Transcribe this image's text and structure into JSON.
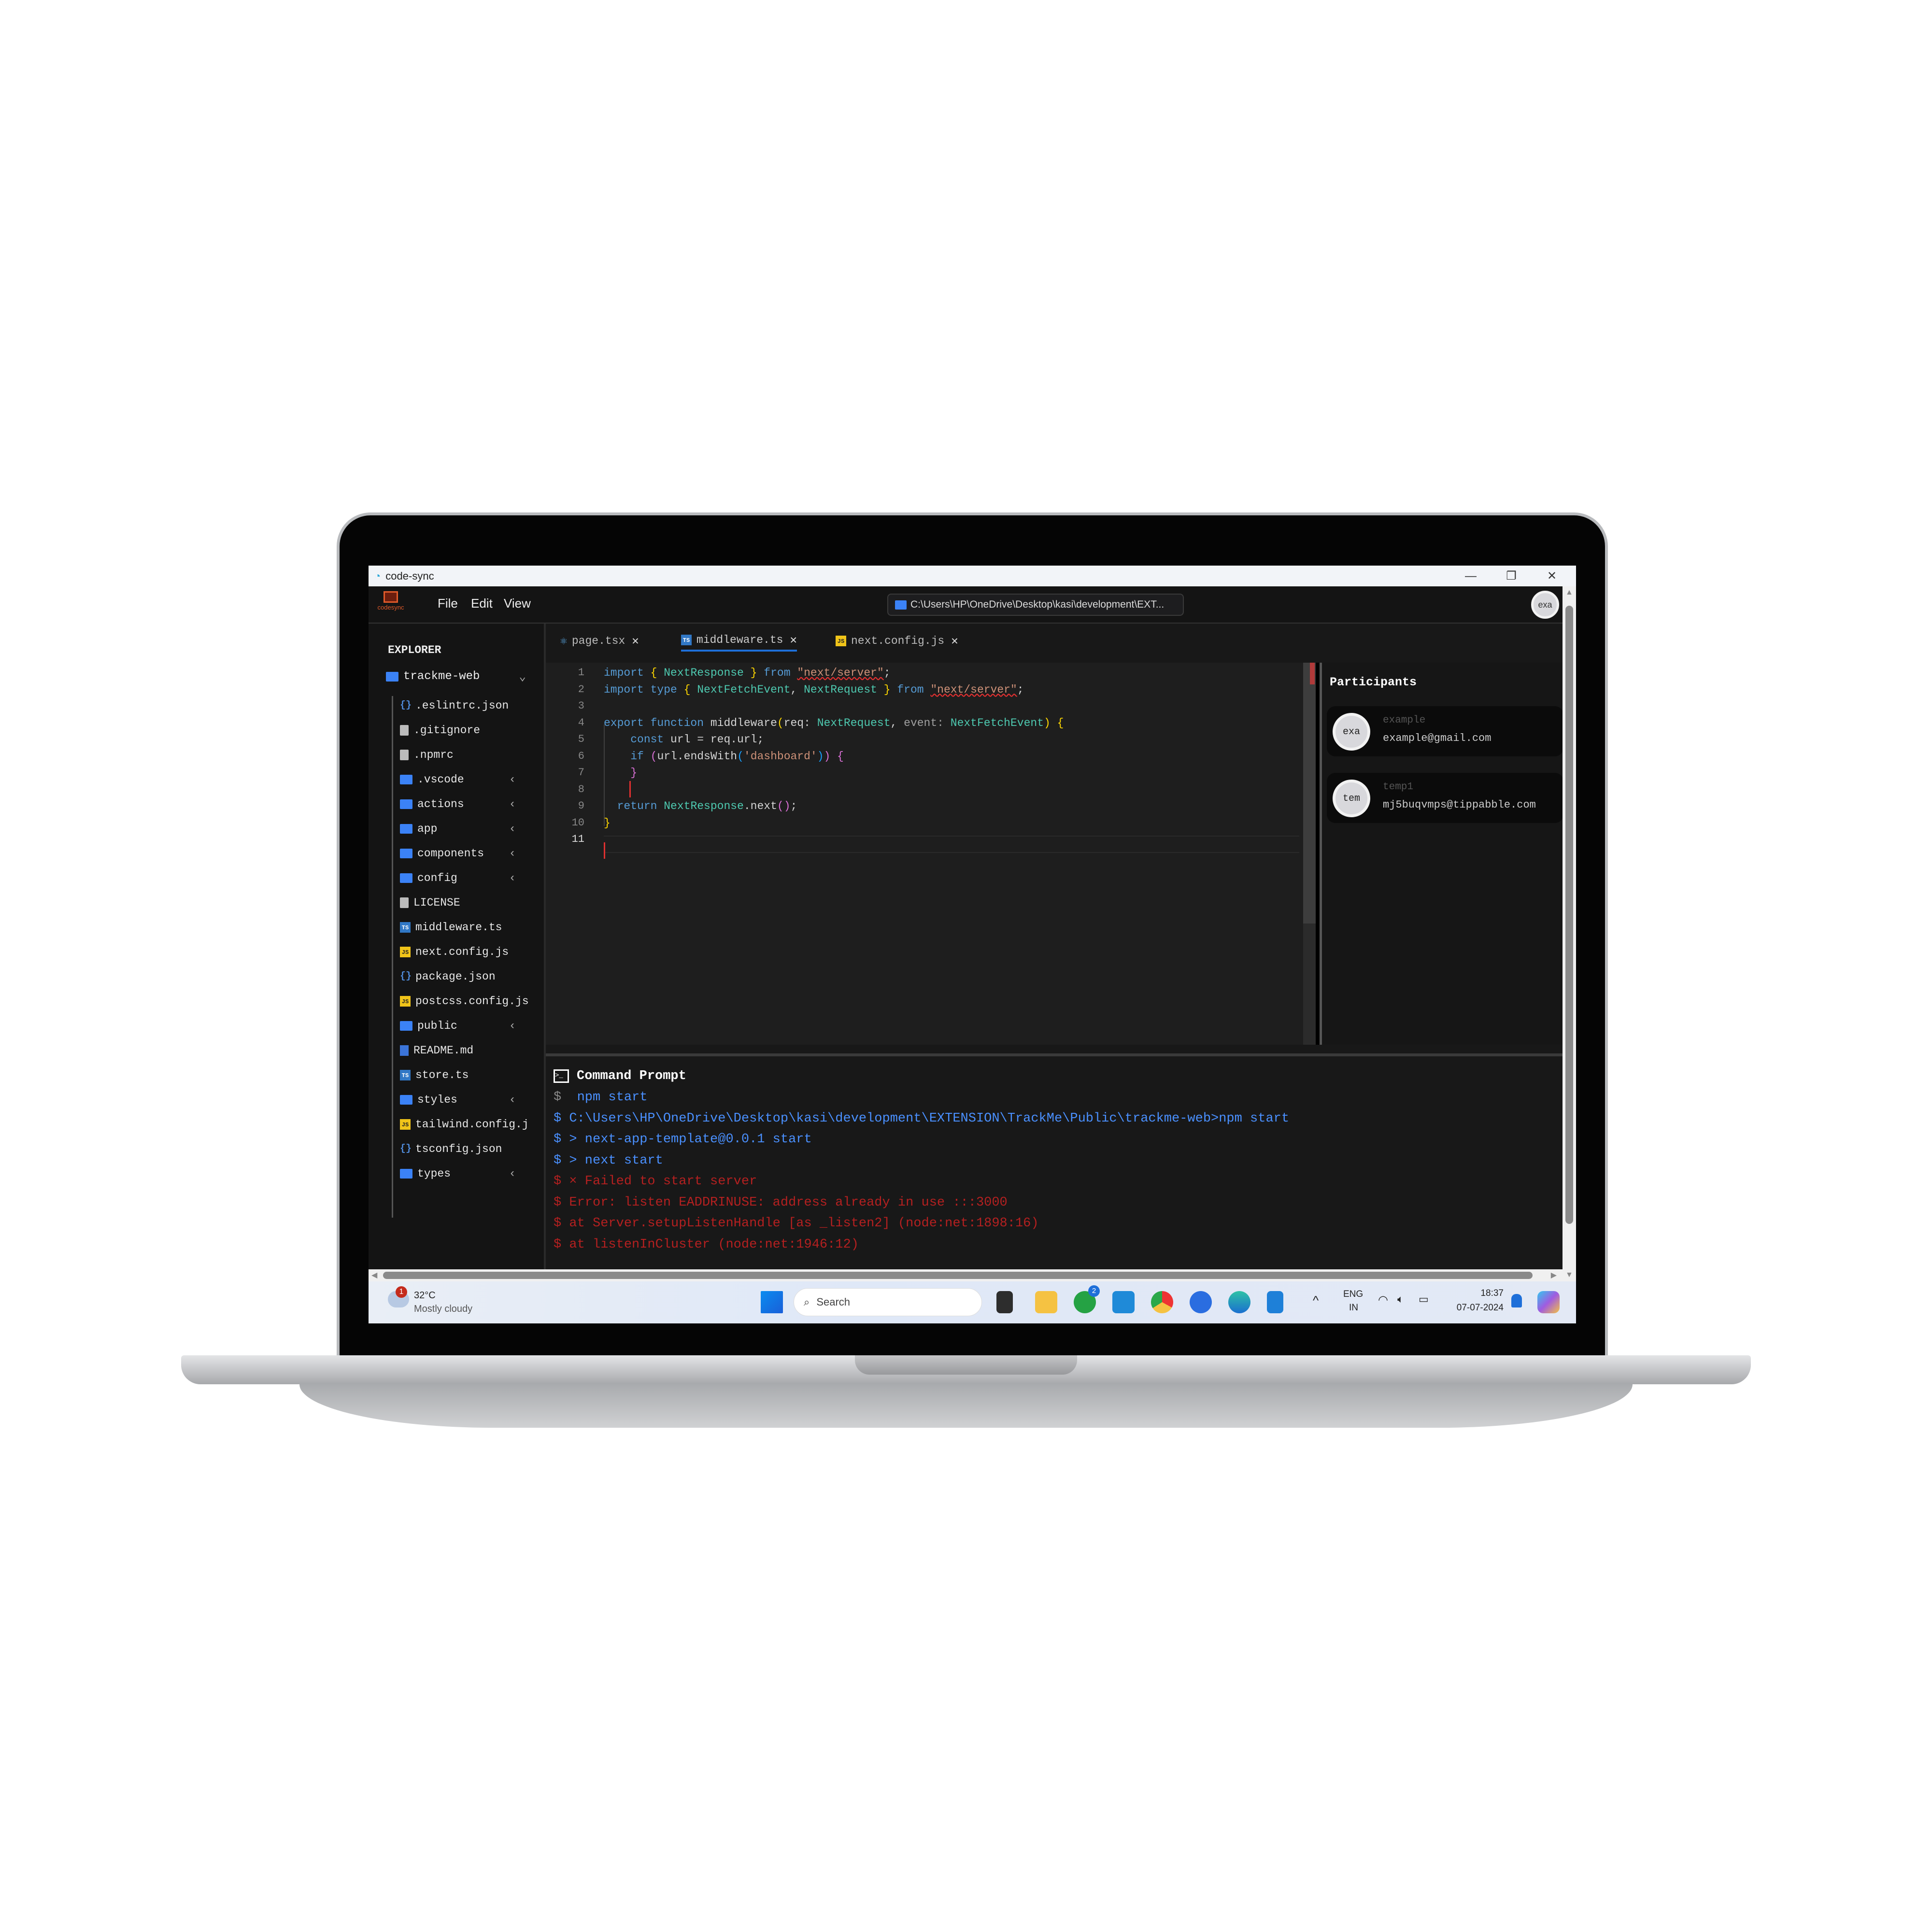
{
  "window": {
    "title": "code-sync",
    "minimize": "—",
    "restore": "❐",
    "close": "✕"
  },
  "header": {
    "logo_text": "codesync",
    "menu": [
      "File",
      "Edit",
      "View"
    ],
    "path": "C:\\Users\\HP\\OneDrive\\Desktop\\kasi\\development\\EXT...",
    "avatar": "exa"
  },
  "explorer": {
    "title": "EXPLORER",
    "root": "trackme-web",
    "items": [
      {
        "name": ".eslintrc.json",
        "icon": "json"
      },
      {
        "name": ".gitignore",
        "icon": "file"
      },
      {
        "name": ".npmrc",
        "icon": "file"
      },
      {
        "name": ".vscode",
        "icon": "folder"
      },
      {
        "name": "actions",
        "icon": "folder"
      },
      {
        "name": "app",
        "icon": "folder"
      },
      {
        "name": "components",
        "icon": "folder"
      },
      {
        "name": "config",
        "icon": "folder"
      },
      {
        "name": "LICENSE",
        "icon": "file"
      },
      {
        "name": "middleware.ts",
        "icon": "ts"
      },
      {
        "name": "next.config.js",
        "icon": "js"
      },
      {
        "name": "package.json",
        "icon": "json"
      },
      {
        "name": "postcss.config.js",
        "icon": "js"
      },
      {
        "name": "public",
        "icon": "folder"
      },
      {
        "name": "README.md",
        "icon": "md"
      },
      {
        "name": "store.ts",
        "icon": "ts"
      },
      {
        "name": "styles",
        "icon": "folder"
      },
      {
        "name": "tailwind.config.j",
        "icon": "js"
      },
      {
        "name": "tsconfig.json",
        "icon": "json"
      },
      {
        "name": "types",
        "icon": "folder"
      }
    ]
  },
  "tabs": [
    {
      "label": "page.tsx",
      "icon": "react",
      "active": false
    },
    {
      "label": "middleware.ts",
      "icon": "ts",
      "active": true
    },
    {
      "label": "next.config.js",
      "icon": "js",
      "active": false
    }
  ],
  "editor": {
    "lines": [
      [
        [
          "import ",
          "kw"
        ],
        [
          "{ ",
          "br"
        ],
        [
          "NextResponse",
          "ty"
        ],
        [
          " } ",
          "br"
        ],
        [
          "from ",
          "kw"
        ],
        [
          "\"next/server\"",
          "st"
        ],
        [
          ";",
          ""
        ]
      ],
      [
        [
          "import type ",
          "kw"
        ],
        [
          "{ ",
          "br"
        ],
        [
          "NextFetchEvent",
          "ty"
        ],
        [
          ", ",
          ""
        ],
        [
          "NextRequest",
          "ty"
        ],
        [
          " } ",
          "br"
        ],
        [
          "from ",
          "kw"
        ],
        [
          "\"next/server\"",
          "st"
        ],
        [
          ";",
          ""
        ]
      ],
      [],
      [
        [
          "export function ",
          "kw"
        ],
        [
          "middleware",
          ""
        ],
        [
          "(",
          "br"
        ],
        [
          "req: ",
          ""
        ],
        [
          "NextRequest",
          "ty"
        ],
        [
          ", ",
          ""
        ],
        [
          "event: ",
          "gr"
        ],
        [
          "NextFetchEvent",
          "ty"
        ],
        [
          ") {",
          "br"
        ]
      ],
      [
        [
          "    const ",
          "kw"
        ],
        [
          "url = req.url;",
          ""
        ]
      ],
      [
        [
          "    if ",
          "kw"
        ],
        [
          "(",
          "pu"
        ],
        [
          "url.endsWith",
          ""
        ],
        [
          "(",
          "bl"
        ],
        [
          "'dashboard'",
          "st2"
        ],
        [
          ")",
          "bl"
        ],
        [
          ") {",
          "pu"
        ]
      ],
      [
        [
          "    }",
          "pu"
        ]
      ],
      [],
      [
        [
          "  return ",
          "kw"
        ],
        [
          "NextResponse",
          "ty"
        ],
        [
          ".next",
          ""
        ],
        [
          "()",
          "pu"
        ],
        [
          ";",
          ""
        ]
      ],
      [
        [
          "}",
          "br"
        ]
      ],
      []
    ]
  },
  "participants": {
    "title": "Participants",
    "list": [
      {
        "initials": "exa",
        "name": "example",
        "email": "example@gmail.com"
      },
      {
        "initials": "tem",
        "name": "temp1",
        "email": "mj5buqvmps@tippabble.com"
      }
    ]
  },
  "terminal": {
    "title": "Command Prompt",
    "lines": [
      {
        "text": " npm start",
        "kind": "blue"
      },
      {
        "text": "C:\\Users\\HP\\OneDrive\\Desktop\\kasi\\development\\EXTENSION\\TrackMe\\Public\\trackme-web>npm start",
        "kind": "blue"
      },
      {
        "text": "> next-app-template@0.0.1 start",
        "kind": "blue"
      },
      {
        "text": "> next start",
        "kind": "blue"
      },
      {
        "text": "× Failed to start server",
        "kind": "red"
      },
      {
        "text": "Error: listen EADDRINUSE: address already in use :::3000",
        "kind": "red"
      },
      {
        "text": "at Server.setupListenHandle [as _listen2] (node:net:1898:16)",
        "kind": "red"
      },
      {
        "text": "at listenInCluster (node:net:1946:12)",
        "kind": "red"
      }
    ]
  },
  "taskbar": {
    "weather_temp": "32°C",
    "weather_desc": "Mostly cloudy",
    "weather_badge": "1",
    "search": "Search",
    "whatsapp_badge": "2",
    "lang": "ENG",
    "region": "IN",
    "time": "18:37",
    "date": "07-07-2024"
  },
  "colors": {
    "accent": "#1e6fd9",
    "error": "#b42020",
    "terminal_text": "#4a90ff"
  }
}
